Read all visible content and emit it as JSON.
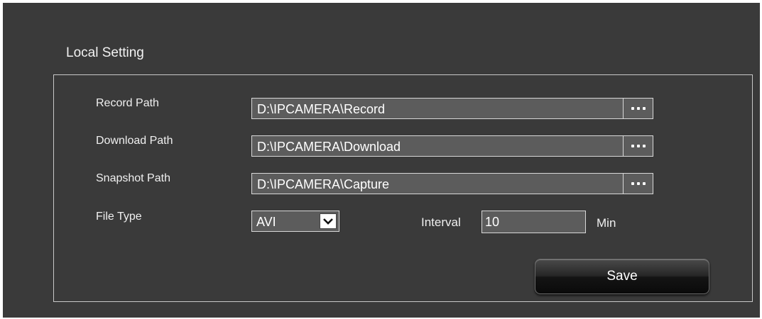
{
  "section": {
    "title": "Local Setting"
  },
  "record_path": {
    "label": "Record Path",
    "value": "D:\\IPCAMERA\\Record",
    "browse_icon": "ellipsis-icon"
  },
  "download_path": {
    "label": "Download Path",
    "value": "D:\\IPCAMERA\\Download",
    "browse_icon": "ellipsis-icon"
  },
  "snapshot_path": {
    "label": "Snapshot Path",
    "value": "D:\\IPCAMERA\\Capture",
    "browse_icon": "ellipsis-icon"
  },
  "file_type": {
    "label": "File Type",
    "selected": "AVI",
    "dropdown_icon": "chevron-down-icon"
  },
  "interval": {
    "label": "Interval",
    "value": "10",
    "unit": "Min"
  },
  "actions": {
    "save_label": "Save"
  },
  "colors": {
    "panel_background": "#3a3a3a",
    "field_background": "#5c5c5c",
    "border": "#d8d8d8",
    "text": "#ffffff"
  }
}
